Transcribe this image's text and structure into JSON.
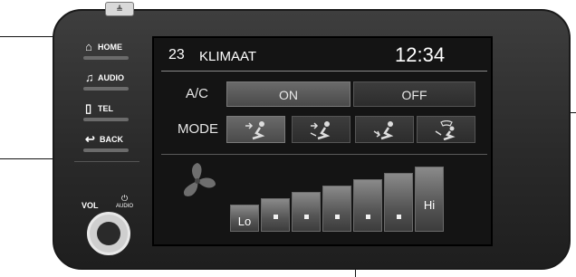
{
  "hardware": {
    "eject_symbol": "≜",
    "buttons": [
      {
        "label": "HOME",
        "icon": "home-icon"
      },
      {
        "label": "AUDIO",
        "icon": "music-note-icon"
      },
      {
        "label": "TEL",
        "icon": "phone-icon"
      },
      {
        "label": "BACK",
        "icon": "back-arrow-icon"
      }
    ],
    "volume_label": "VOL",
    "power_audio_label": "AUDIO"
  },
  "screen": {
    "header": {
      "number": "23",
      "title": "KLIMAAT",
      "clock": "12:34"
    },
    "ac": {
      "label": "A/C",
      "on_label": "ON",
      "off_label": "OFF",
      "selected": "ON"
    },
    "mode": {
      "label": "MODE",
      "options": [
        "face-vent-icon",
        "face-foot-vent-icon",
        "foot-vent-icon",
        "defrost-foot-vent-icon"
      ],
      "selected_index": 0
    },
    "fan": {
      "icon": "fan-icon",
      "low_label": "Lo",
      "high_label": "Hi",
      "steps": 7,
      "current_level": 1
    }
  },
  "colors": {
    "screen_bg": "#141414",
    "bezel": "#2a2a2a",
    "selected_button": "#5a5a5a"
  }
}
